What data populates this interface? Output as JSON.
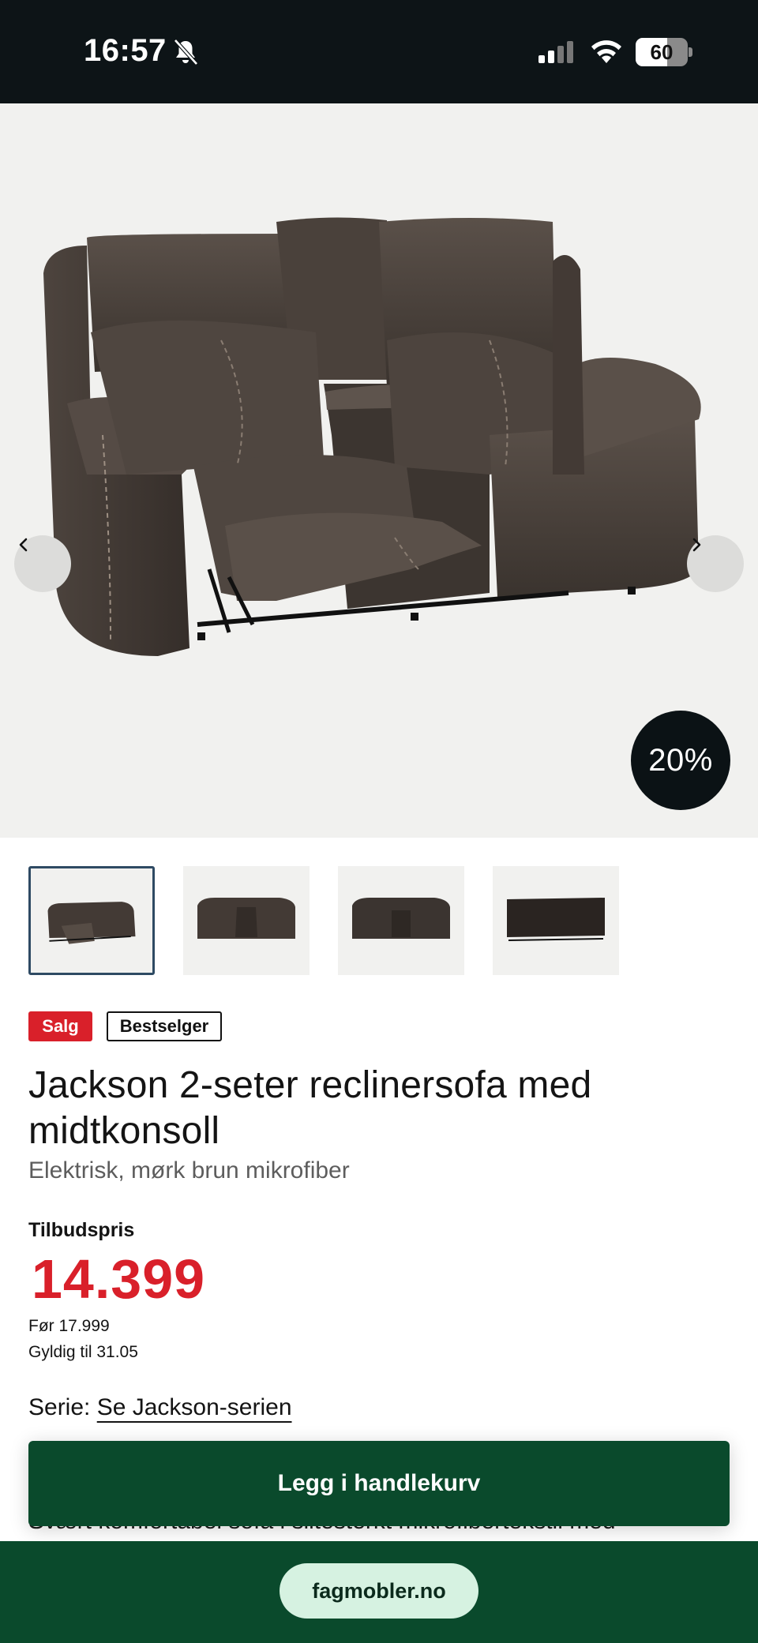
{
  "status_bar": {
    "time": "16:57",
    "battery_level": "60",
    "battery_fraction": 0.6,
    "icons": [
      "bell-slash-icon",
      "cellular-signal-icon",
      "wifi-icon",
      "battery-icon"
    ]
  },
  "gallery": {
    "prev_icon": "chevron-left-icon",
    "next_icon": "chevron-right-icon",
    "discount_badge": "20%",
    "thumbnail_count": 4,
    "active_thumbnail": 1
  },
  "badges": {
    "sale": "Salg",
    "bestseller": "Bestselger"
  },
  "product": {
    "title_line1": "Jackson 2-seter reclinersofa med",
    "title_line2": "midtkonsoll",
    "subtitle": "Elektrisk, mørk brun mikrofiber"
  },
  "price": {
    "label": "Tilbudspris",
    "offer": "14.399",
    "before": "Før 17.999",
    "valid_until": "Gyldig til 31.05"
  },
  "series": {
    "label": "Serie:",
    "link": "Se Jackson-serien"
  },
  "description_peek": "Svært komfortabel sofa i slitesterkt mikrofibertekstil med",
  "cart": {
    "button_label": "Legg i handlekurv"
  },
  "browser": {
    "url": "fagmobler.no"
  },
  "colors": {
    "accent_red": "#d9202a",
    "brand_green": "#0a4a2c",
    "url_pill": "#d6f2e1",
    "status_bar_bg": "#0d1417"
  }
}
